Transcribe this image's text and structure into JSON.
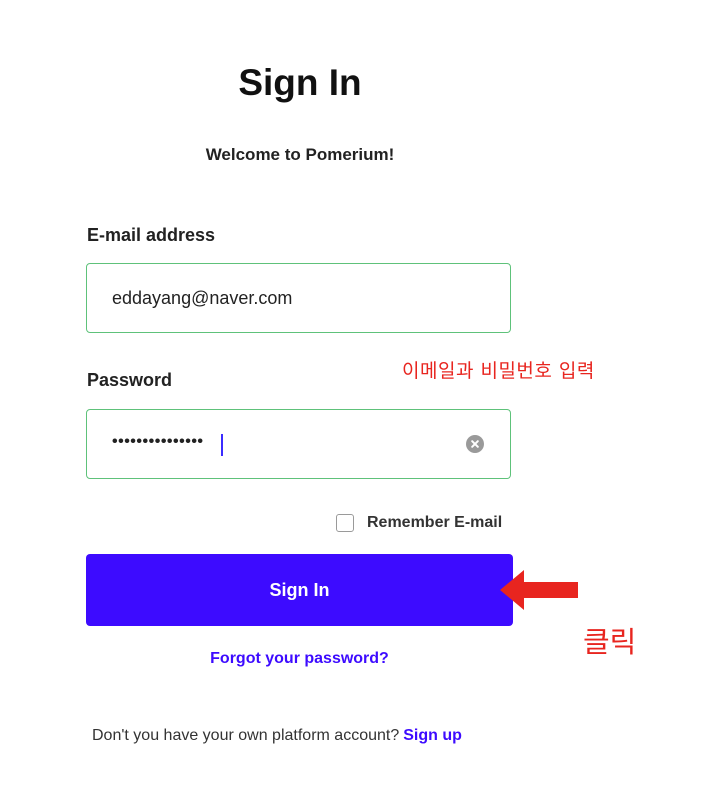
{
  "header": {
    "title": "Sign In",
    "subtitle": "Welcome to Pomerium!"
  },
  "email": {
    "label": "E-mail address",
    "value": "eddayang@naver.com"
  },
  "password": {
    "label": "Password",
    "masked_value": "•••••••••••••••"
  },
  "remember": {
    "label": "Remember E-mail",
    "checked": false
  },
  "actions": {
    "sign_in_label": "Sign In",
    "forgot_label": "Forgot your password?"
  },
  "signup": {
    "prompt": "Don't you have your own platform account?",
    "link_label": "Sign up"
  },
  "annotations": {
    "input_note": "이메일과 비밀번호 입력",
    "click_note": "클릭",
    "color": "#e8251f"
  },
  "colors": {
    "accent": "#3d0bff",
    "field_border": "#5ec27a"
  },
  "icons": {
    "clear": "clear-circle-icon",
    "arrow": "left-arrow-icon"
  }
}
